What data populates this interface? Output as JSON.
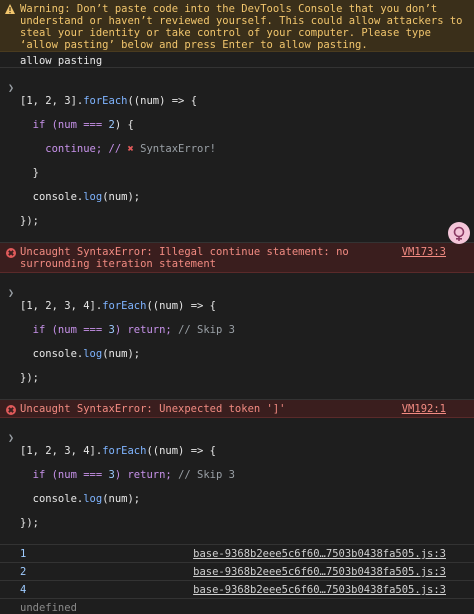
{
  "warning": {
    "text": "Warning: Don’t paste code into the DevTools Console that you don’t understand or haven’t reviewed yourself. This could allow attackers to steal your identity or take control of your computer. Please type ‘allow pasting’ below and press Enter to allow pasting."
  },
  "paste_text": "allow pasting",
  "cmd1": {
    "l1a": "[1, 2, 3].",
    "l1b": "forEach",
    "l1c": "((num) => {",
    "l2a": "  if (num === ",
    "l2b": "2",
    "l2c": ") {",
    "l3a": "    continue; // ",
    "l3x": "✖",
    "l3b": " SyntaxError!",
    "l4": "  }",
    "l5a": "  console.",
    "l5b": "log",
    "l5c": "(num);",
    "l6": "});"
  },
  "err1": {
    "text": "Uncaught SyntaxError: Illegal continue statement: no surrounding iteration statement",
    "loc": "VM173:3"
  },
  "cmd2": {
    "l1a": "[1, 2, 3, 4].",
    "l1b": "forEach",
    "l1c": "((num) => {",
    "l2a": "  if (num === ",
    "l2b": "3",
    "l2c": ") return; ",
    "l2d": "// Skip 3",
    "l3a": "  console.",
    "l3b": "log",
    "l3c": "(num);",
    "l4": "});"
  },
  "err2": {
    "text": "Uncaught SyntaxError: Unexpected token ']'",
    "loc": "VM192:1"
  },
  "cmd3": {
    "l1a": "[1, 2, 3, 4].",
    "l1b": "forEach",
    "l1c": "((num) => {",
    "l2a": "  if (num === ",
    "l2b": "3",
    "l2c": ") return; ",
    "l2d": "// Skip 3",
    "l3a": "  console.",
    "l3b": "log",
    "l3c": "(num);",
    "l4": "});"
  },
  "logs": [
    {
      "value": "1",
      "source": "base-9368b2eee5c6f60…7503b0438fa505.js:3"
    },
    {
      "value": "2",
      "source": "base-9368b2eee5c6f60…7503b0438fa505.js:3"
    },
    {
      "value": "4",
      "source": "base-9368b2eee5c6f60…7503b0438fa505.js:3"
    }
  ],
  "result": "undefined",
  "icons": {
    "warning": "warning-icon",
    "error": "error-icon",
    "prompt": "chevron-right-icon",
    "assistant": "assistant-icon"
  }
}
